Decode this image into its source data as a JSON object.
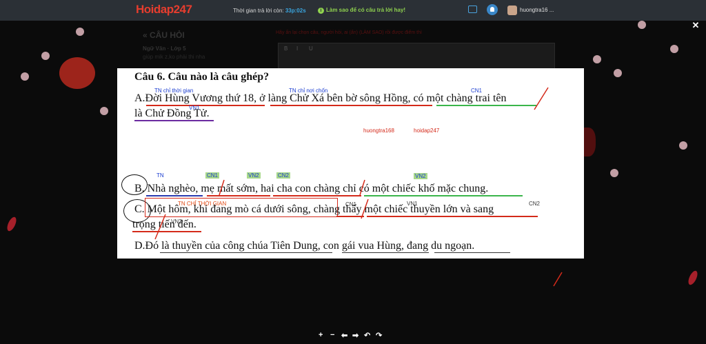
{
  "header": {
    "logo": "Hoidap247",
    "timer_label": "Thời gian trả lời còn: ",
    "timer_value": "33p:02s",
    "tip": "Làm sao để có câu trả lời hay!",
    "tip_icon": "i",
    "username": "huongtra16 ..."
  },
  "background_panel": {
    "back_title": "« CÂU HỎI",
    "subject": "Ngữ Văn · Lớp 5",
    "hint": "giúp mik z,ko phải thi nha",
    "warning": "Hãy ấn lại chọn câu, người hỏi, ai (ẩn) (LÀM SAO) rồi được điểm thì",
    "editor_tools": [
      "B",
      "I",
      "U"
    ]
  },
  "document": {
    "question": "Câu 6. Câu nào là câu ghép?",
    "lineA1": "A.Đời Hùng Vương thứ 18, ở làng Chử Xá bên bờ sông Hồng, có một chàng trai tên",
    "lineA2": "là Chử Đồng Tử.",
    "lineB": "B. Nhà nghèo, mẹ mất sớm, hai cha con chàng chỉ có một chiếc khố mặc chung.",
    "lineC1": "C. Một hôm, khi đang mò cá dưới sông, chàng thấy một chiếc thuyền lớn và sang",
    "lineC2": "trọng tiến đến.",
    "lineD": "D.Đó là thuyền của công chúa Tiên Dung, con gái vua Hùng, đang du ngoạn.",
    "annotations": {
      "tn_thoi_gian": "TN chỉ thời gian",
      "tn_noi_chon": "TN chỉ nơi chốn",
      "cn1_a": "CN1",
      "vn1_a": "VN1",
      "watermark_user": "huongtra168",
      "watermark_site": "hoidap247",
      "tn_b": "TN",
      "cn1_b": "CN1",
      "vn2_b": "VN2",
      "cn2_b": "CN2",
      "vn2_b2": "VN2",
      "tn_c": "TN CHỈ THỜI GIAN",
      "cn1_c": "CN1",
      "vn1_c": "VN1",
      "cn2_c": "CN2",
      "vn2_c": "VN2"
    }
  },
  "viewer_tools": [
    "+",
    "−",
    "⬅",
    "➡",
    "↶",
    "↷"
  ],
  "colors": {
    "topbar": "#2b3036",
    "logo": "#e63d2e",
    "timer_value": "#3aa6e0",
    "tip": "#8fd14f",
    "annotation_blue": "#1a3cd0",
    "annotation_red": "#d42a1a",
    "annotation_green_bg": "#a8d88a"
  },
  "icons": {
    "chat": "chat-icon",
    "bell": "bell-icon",
    "close": "close-icon",
    "tip": "info-icon"
  }
}
